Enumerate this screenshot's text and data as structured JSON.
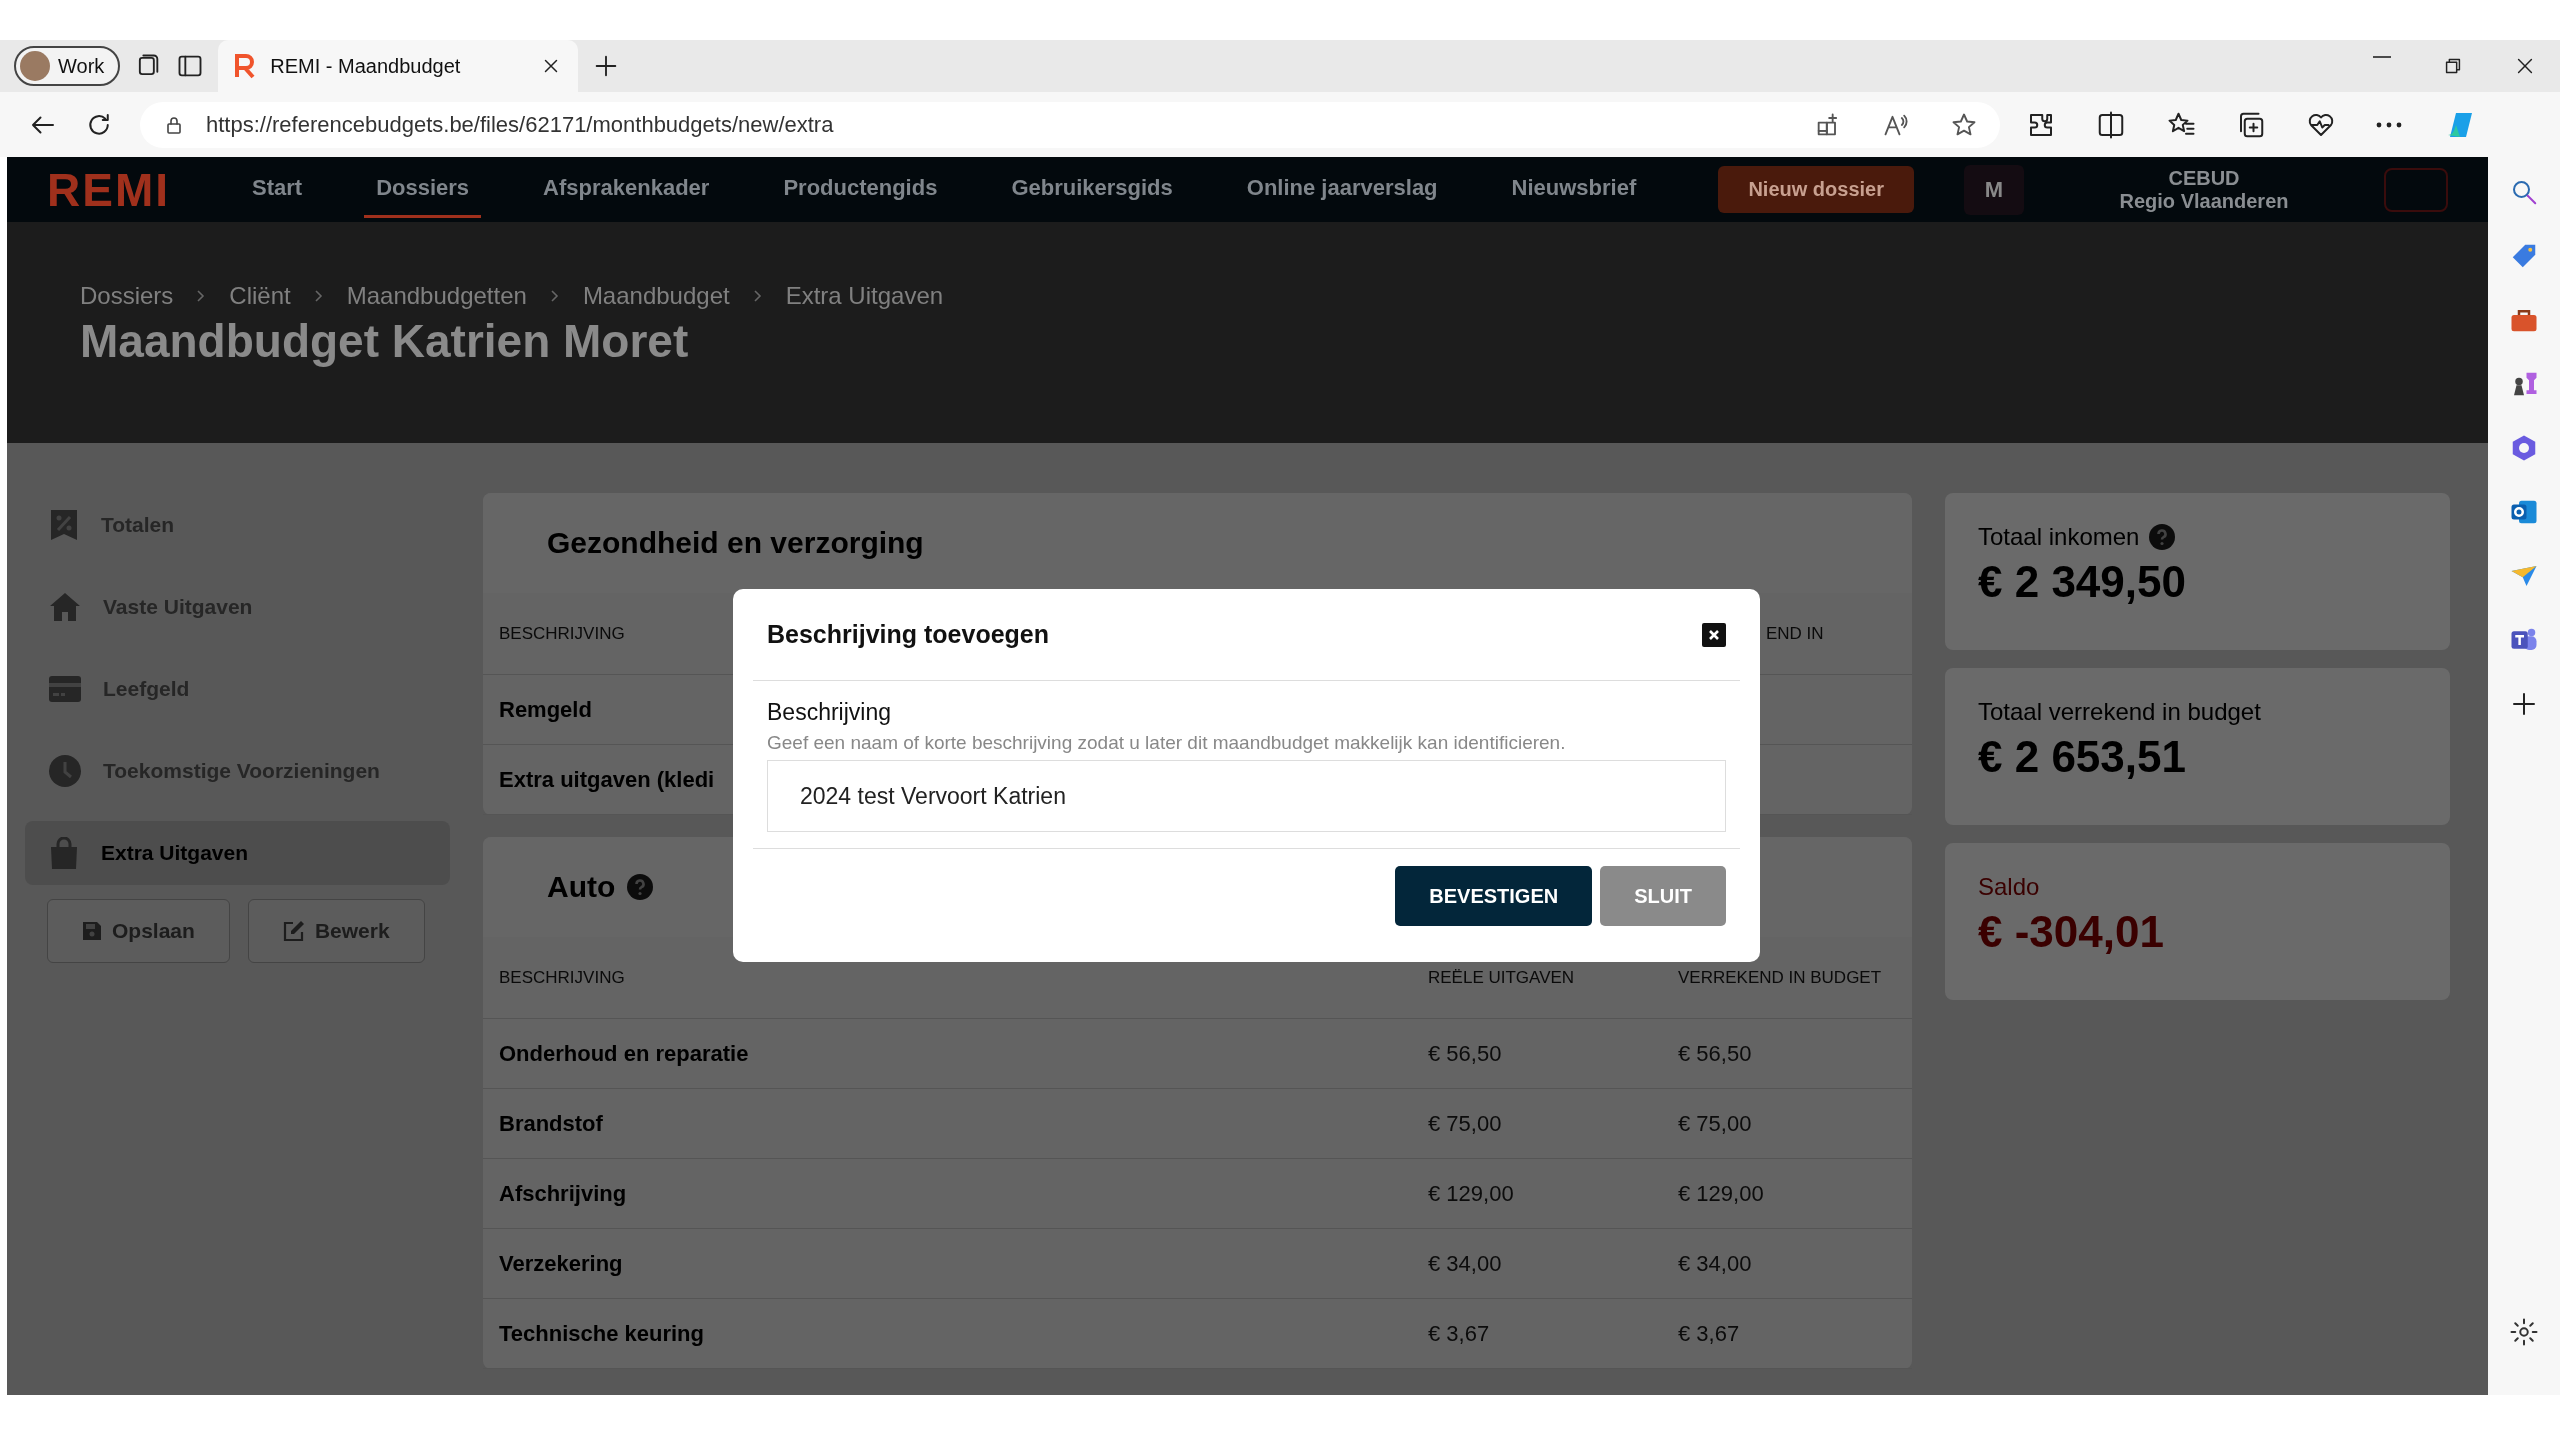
{
  "browser": {
    "profile": "Work",
    "tabs": [
      {
        "title": "REMI - Maandbudget",
        "selected": true
      }
    ],
    "url": "https://referencebudgets.be/files/62171/monthbudgets/new/extra"
  },
  "nav": {
    "logo": "REMI",
    "items": [
      {
        "label": "Start",
        "selected": false
      },
      {
        "label": "Dossiers",
        "selected": true
      },
      {
        "label": "Afsprakenkader",
        "selected": false
      },
      {
        "label": "Productengids",
        "selected": false
      },
      {
        "label": "Gebruikersgids",
        "selected": false
      },
      {
        "label": "Online jaarverslag",
        "selected": false
      },
      {
        "label": "Nieuwsbrief",
        "selected": false
      }
    ],
    "new_button": "Nieuw dossier",
    "avatar": "M",
    "org": "CEBUD",
    "region": "Regio Vlaanderen"
  },
  "header": {
    "breadcrumbs": [
      "Dossiers",
      "Cliënt",
      "Maandbudgetten",
      "Maandbudget",
      "Extra Uitgaven"
    ],
    "title": "Maandbudget Katrien Moret"
  },
  "sidebar": {
    "items": [
      {
        "label": "Totalen",
        "kind": "receipt",
        "selected": false
      },
      {
        "label": "Vaste Uitgaven",
        "kind": "home",
        "selected": false
      },
      {
        "label": "Leefgeld",
        "kind": "card",
        "selected": false
      },
      {
        "label": "Toekomstige Voorzieningen",
        "kind": "clock",
        "selected": false
      },
      {
        "label": "Extra Uitgaven",
        "kind": "bag",
        "selected": true
      }
    ],
    "buttons": [
      {
        "label": "Opslaan",
        "kind": "save"
      },
      {
        "label": "Bewerk",
        "kind": "edit"
      }
    ]
  },
  "sections": [
    {
      "title": "Gezondheid en verzorging",
      "help": false,
      "columns": [
        {
          "label": "BESCHRIJVING",
          "kind": "description"
        },
        {
          "label": "END IN",
          "kind": "partial"
        }
      ],
      "rows": [
        {
          "description": "Remgeld"
        },
        {
          "description": "Extra uitgaven (kledi"
        }
      ]
    },
    {
      "title": "Auto",
      "help": true,
      "columns": [
        {
          "label": "BESCHRIJVING",
          "kind": "description"
        },
        {
          "label": "REËLE UITGAVEN",
          "kind": "real"
        },
        {
          "label": "VERREKEND IN BUDGET",
          "kind": "budget"
        }
      ],
      "rows": [
        {
          "description": "Onderhoud en reparatie",
          "real": "€ 56,50",
          "budget": "€ 56,50"
        },
        {
          "description": "Brandstof",
          "real": "€ 75,00",
          "budget": "€ 75,00"
        },
        {
          "description": "Afschrijving",
          "real": "€ 129,00",
          "budget": "€ 129,00"
        },
        {
          "description": "Verzekering",
          "real": "€ 34,00",
          "budget": "€ 34,00"
        },
        {
          "description": "Technische keuring",
          "real": "€ 3,67",
          "budget": "€ 3,67"
        }
      ]
    }
  ],
  "totals": [
    {
      "label": "Totaal inkomen",
      "help": true,
      "amount": "€ 2 349,50",
      "negative": false
    },
    {
      "label": "Totaal verrekend in budget",
      "help": false,
      "amount": "€ 2 653,51",
      "negative": false
    },
    {
      "label": "Saldo",
      "help": false,
      "amount": "€ -304,01",
      "negative": true
    }
  ],
  "dialog": {
    "title": "Beschrijving toevoegen",
    "field_label": "Beschrijving",
    "hint": "Geef een naam of korte beschrijving zodat u later dit maandbudget makkelijk kan identificieren.",
    "value": "2024 test Vervoort Katrien",
    "buttons": [
      {
        "label": "BEVESTIGEN",
        "kind": "primary"
      },
      {
        "label": "SLUIT",
        "kind": "secondary"
      }
    ]
  }
}
